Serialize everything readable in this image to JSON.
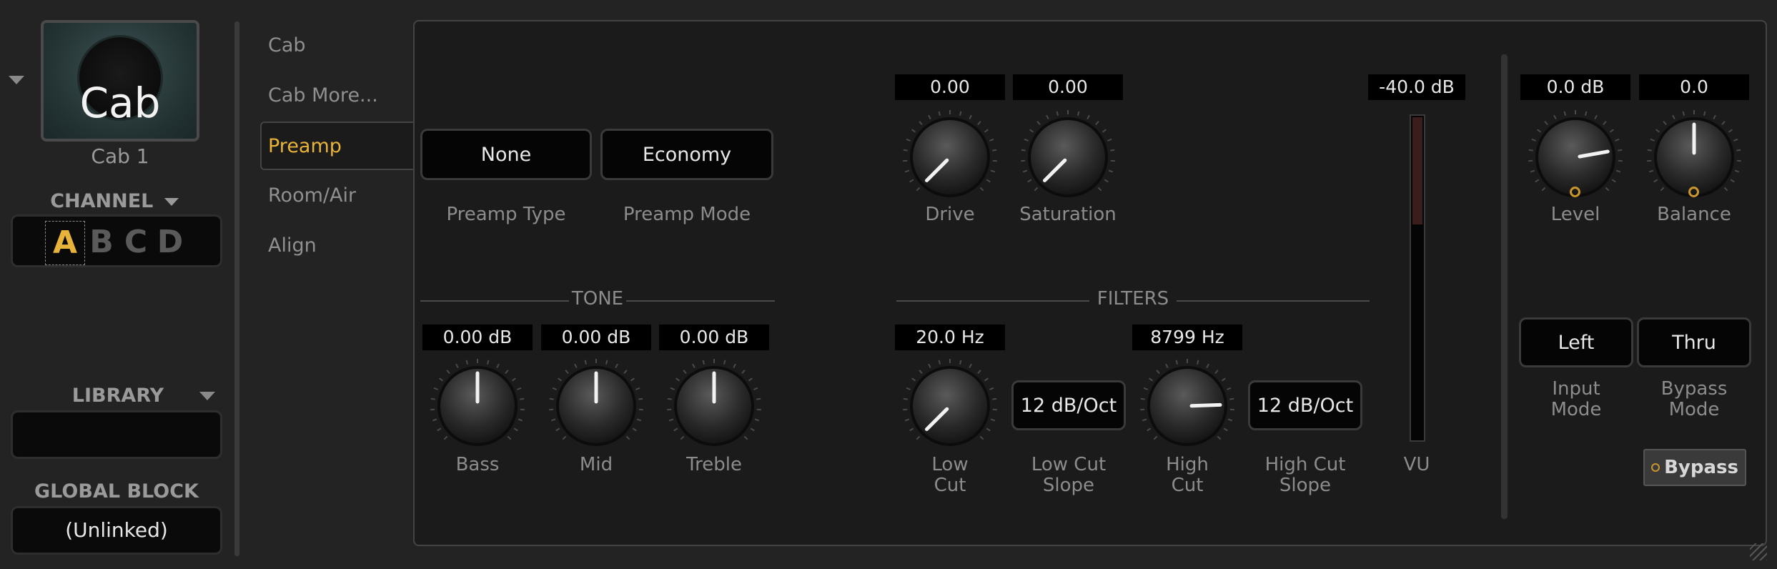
{
  "block": {
    "icon_label": "Cab",
    "name": "Cab 1"
  },
  "channel": {
    "title": "CHANNEL",
    "letters": [
      "A",
      "B",
      "C",
      "D"
    ],
    "active": "A"
  },
  "library": {
    "title": "LIBRARY",
    "value": ""
  },
  "global_block": {
    "title": "GLOBAL BLOCK",
    "value": "(Unlinked)"
  },
  "pages": [
    "Cab",
    "Cab More...",
    "Preamp",
    "Room/Air",
    "Align"
  ],
  "active_page": "Preamp",
  "preamp": {
    "type": {
      "value": "None",
      "label": "Preamp Type"
    },
    "mode": {
      "value": "Economy",
      "label": "Preamp Mode"
    }
  },
  "knobs": {
    "drive": {
      "value": "0.00",
      "label": "Drive"
    },
    "saturation": {
      "value": "0.00",
      "label": "Saturation"
    },
    "bass": {
      "value": "0.00 dB",
      "label": "Bass"
    },
    "mid": {
      "value": "0.00 dB",
      "label": "Mid"
    },
    "treble": {
      "value": "0.00 dB",
      "label": "Treble"
    },
    "low_cut": {
      "value": "20.0 Hz",
      "label": "Low\nCut"
    },
    "high_cut": {
      "value": "8799 Hz",
      "label": "High\nCut"
    },
    "level": {
      "value": "0.0 dB",
      "label": "Level"
    },
    "balance": {
      "value": "0.0",
      "label": "Balance"
    }
  },
  "sections": {
    "tone": "TONE",
    "filters": "FILTERS"
  },
  "low_cut_slope": {
    "value": "12 dB/Oct",
    "label": "Low Cut\nSlope"
  },
  "high_cut_slope": {
    "value": "12 dB/Oct",
    "label": "High Cut\nSlope"
  },
  "vu": {
    "value": "-40.0 dB",
    "label": "VU"
  },
  "input_mode": {
    "value": "Left",
    "label": "Input\nMode"
  },
  "bypass_mode": {
    "value": "Thru",
    "label": "Bypass\nMode"
  },
  "bypass_button": "Bypass",
  "colors": {
    "accent": "#e8b33a",
    "panel": "#1b1b1b",
    "background": "#232323"
  }
}
